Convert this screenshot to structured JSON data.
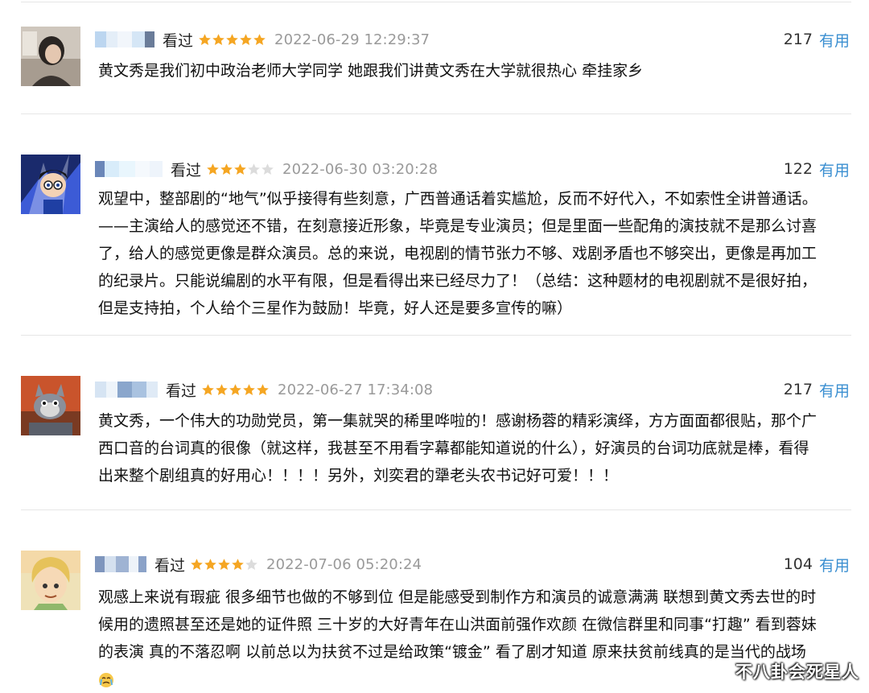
{
  "reviews": [
    {
      "status": "看过",
      "rating": 5,
      "time": "2022-06-29 12:29:37",
      "useful_count": "217",
      "useful_label": "有用",
      "lines": [
        "黄文秀是我们初中政治老师大学同学 她跟我们讲黄文秀在大学就很热心 牵挂家乡"
      ]
    },
    {
      "status": "看过",
      "rating": 3,
      "time": "2022-06-30 03:20:28",
      "useful_count": "122",
      "useful_label": "有用",
      "lines": [
        "观望中，整部剧的“地气”似乎接得有些刻意，广西普通话着实尴尬，反而不好代入，不如索性全讲普通话。",
        "——主演给人的感觉还不错，在刻意接近形象，毕竟是专业演员；但是里面一些配角的演技就不是那么讨喜",
        "了，给人的感觉更像是群众演员。总的来说，电视剧的情节张力不够、戏剧矛盾也不够突出，更像是再加工",
        "的纪录片。只能说编剧的水平有限，但是看得出来已经尽力了！（总结：这种题材的电视剧就不是很好拍，",
        "但是支持拍，个人给个三星作为鼓励！毕竟，好人还是要多宣传的嘛）"
      ]
    },
    {
      "status": "看过",
      "rating": 5,
      "time": "2022-06-27 17:34:08",
      "useful_count": "217",
      "useful_label": "有用",
      "lines": [
        "黄文秀，一个伟大的功勋党员，第一集就哭的稀里哗啦的！感谢杨蓉的精彩演绎，方方面面都很贴，那个广",
        "西口音的台词真的很像（就这样，我甚至不用看字幕都能知道说的什么），好演员的台词功底就是棒，看得",
        "出来整个剧组真的好用心！！！！另外，刘奕君的犟老头农书记好可爱！！！"
      ]
    },
    {
      "status": "看过",
      "rating": 4,
      "time": "2022-07-06 05:20:24",
      "useful_count": "104",
      "useful_label": "有用",
      "lines": [
        "观感上来说有瑕疵 很多细节也做的不够到位 但是能感受到制作方和演员的诚意满满 联想到黄文秀去世的时",
        "候用的遗照甚至还是她的证件照 三十岁的大好青年在山洪面前强作欢颜 在微信群里和同事“打趣” 看到蓉妹",
        "的表演 真的不落忍啊 以前总以为扶贫不过是给政策“镀金” 看了剧才知道 原来扶贫前线真的是当代的战场"
      ],
      "emoji": "crying-face-icon"
    }
  ],
  "watermark": "不八卦会死星人",
  "colors": {
    "star": "#f5a623",
    "star_empty": "#dcdcdc",
    "link": "#3b8fd1",
    "time": "#9a9a9a"
  }
}
